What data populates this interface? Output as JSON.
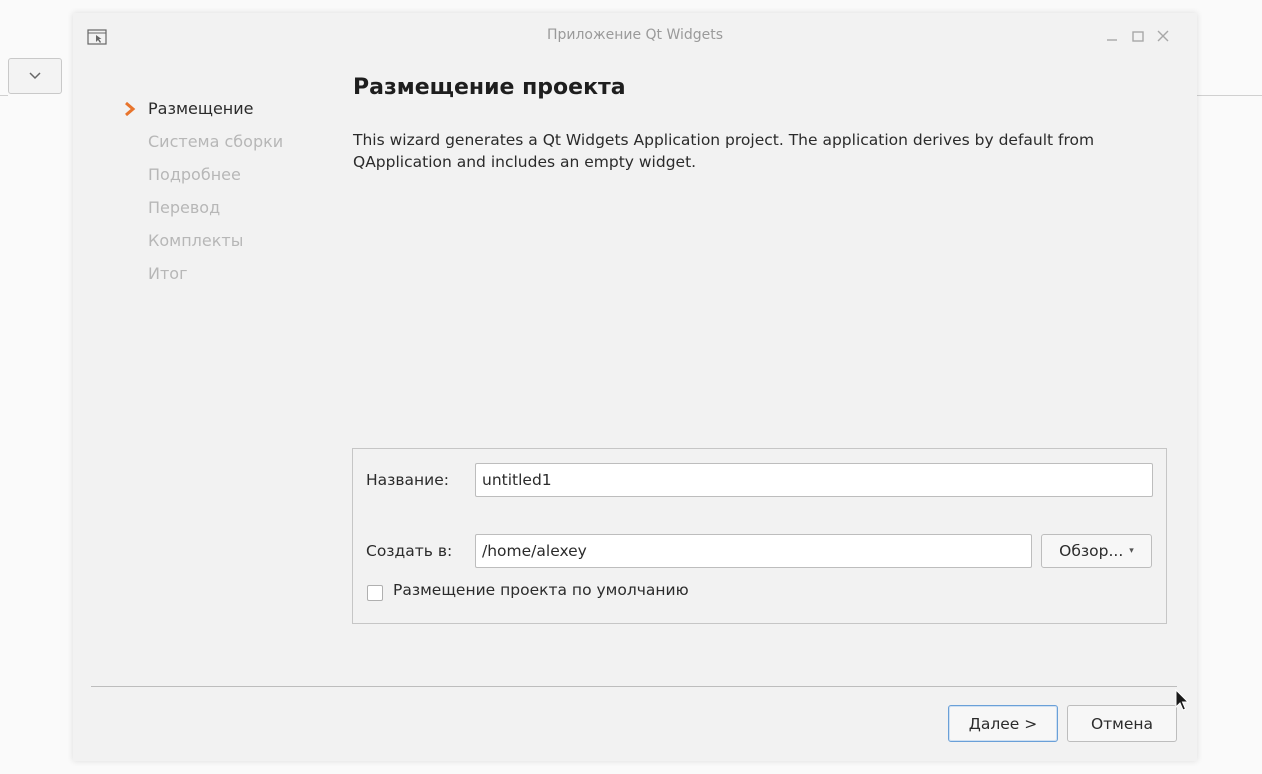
{
  "window": {
    "title": "Приложение Qt Widgets"
  },
  "steps": [
    {
      "label": "Размещение",
      "active": true
    },
    {
      "label": "Система сборки",
      "active": false
    },
    {
      "label": "Подробнее",
      "active": false
    },
    {
      "label": "Перевод",
      "active": false
    },
    {
      "label": "Комплекты",
      "active": false
    },
    {
      "label": "Итог",
      "active": false
    }
  ],
  "page": {
    "heading": "Размещение проекта",
    "description": "This wizard generates a Qt Widgets Application project. The application derives by default from QApplication and includes an empty widget."
  },
  "form": {
    "name_label": "Название:",
    "name_value": "untitled1",
    "location_label": "Создать в:",
    "location_value": "/home/alexey",
    "browse_label": "Обзор...",
    "default_location_label": "Размещение проекта по умолчанию",
    "default_location_checked": false
  },
  "buttons": {
    "next_mnemonic": "Д",
    "next_rest": "алее >",
    "cancel": "Отмена"
  },
  "colors": {
    "active_step_arrow": "#e8742c",
    "default_button_border": "#6aa0d8"
  }
}
